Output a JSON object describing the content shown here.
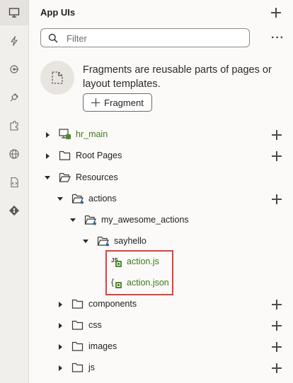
{
  "panel": {
    "title": "App UIs",
    "search_placeholder": "Filter",
    "more_label": "···",
    "info_text": "Fragments are reusable parts of pages or layout templates.",
    "fragment_button": "Fragment"
  },
  "rail": {
    "items": [
      "desktop-icon",
      "lightning-icon",
      "service-icon",
      "plug-icon",
      "puzzle-icon",
      "globe-icon",
      "file-code-icon",
      "git-icon"
    ]
  },
  "tree": {
    "hr_main": "hr_main",
    "root_pages": "Root Pages",
    "resources": "Resources",
    "actions": "actions",
    "my_awesome_actions": "my_awesome_actions",
    "sayhello": "sayhello",
    "action_js": "action.js",
    "action_json": "action.json",
    "components": "components",
    "css": "css",
    "images": "images",
    "js": "js"
  },
  "colors": {
    "green_text": "#3a7b1c",
    "highlight": "#e0403a"
  }
}
